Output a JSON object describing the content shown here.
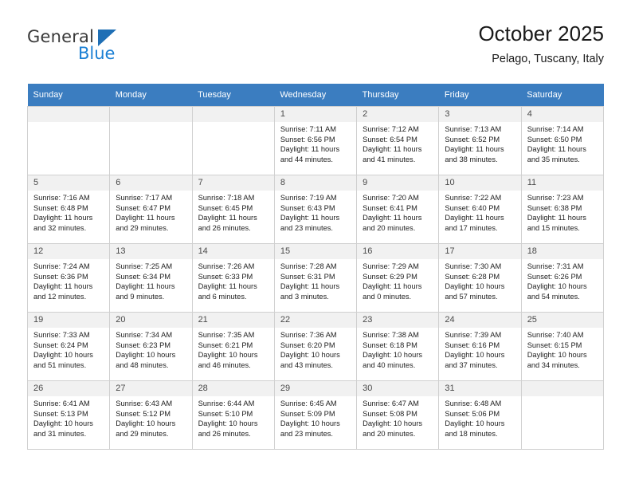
{
  "brand": {
    "name_top": "General",
    "name_bottom": "Blue",
    "accent_color": "#1a7fd4",
    "triangle_color": "#1f6fb5"
  },
  "header": {
    "title": "October 2025",
    "subtitle": "Pelago, Tuscany, Italy"
  },
  "theme": {
    "header_row_bg": "#3b7dc0",
    "daynum_bg": "#f1f1f1",
    "grid_line": "#d0d0d0"
  },
  "weekdays": [
    "Sunday",
    "Monday",
    "Tuesday",
    "Wednesday",
    "Thursday",
    "Friday",
    "Saturday"
  ],
  "labels": {
    "sunrise": "Sunrise:",
    "sunset": "Sunset:",
    "daylight": "Daylight:"
  },
  "weeks": [
    [
      {
        "day": "",
        "empty": true
      },
      {
        "day": "",
        "empty": true
      },
      {
        "day": "",
        "empty": true
      },
      {
        "day": "1",
        "sunrise": "Sunrise: 7:11 AM",
        "sunset": "Sunset: 6:56 PM",
        "daylight_1": "Daylight: 11 hours",
        "daylight_2": "and 44 minutes."
      },
      {
        "day": "2",
        "sunrise": "Sunrise: 7:12 AM",
        "sunset": "Sunset: 6:54 PM",
        "daylight_1": "Daylight: 11 hours",
        "daylight_2": "and 41 minutes."
      },
      {
        "day": "3",
        "sunrise": "Sunrise: 7:13 AM",
        "sunset": "Sunset: 6:52 PM",
        "daylight_1": "Daylight: 11 hours",
        "daylight_2": "and 38 minutes."
      },
      {
        "day": "4",
        "sunrise": "Sunrise: 7:14 AM",
        "sunset": "Sunset: 6:50 PM",
        "daylight_1": "Daylight: 11 hours",
        "daylight_2": "and 35 minutes."
      }
    ],
    [
      {
        "day": "5",
        "sunrise": "Sunrise: 7:16 AM",
        "sunset": "Sunset: 6:48 PM",
        "daylight_1": "Daylight: 11 hours",
        "daylight_2": "and 32 minutes."
      },
      {
        "day": "6",
        "sunrise": "Sunrise: 7:17 AM",
        "sunset": "Sunset: 6:47 PM",
        "daylight_1": "Daylight: 11 hours",
        "daylight_2": "and 29 minutes."
      },
      {
        "day": "7",
        "sunrise": "Sunrise: 7:18 AM",
        "sunset": "Sunset: 6:45 PM",
        "daylight_1": "Daylight: 11 hours",
        "daylight_2": "and 26 minutes."
      },
      {
        "day": "8",
        "sunrise": "Sunrise: 7:19 AM",
        "sunset": "Sunset: 6:43 PM",
        "daylight_1": "Daylight: 11 hours",
        "daylight_2": "and 23 minutes."
      },
      {
        "day": "9",
        "sunrise": "Sunrise: 7:20 AM",
        "sunset": "Sunset: 6:41 PM",
        "daylight_1": "Daylight: 11 hours",
        "daylight_2": "and 20 minutes."
      },
      {
        "day": "10",
        "sunrise": "Sunrise: 7:22 AM",
        "sunset": "Sunset: 6:40 PM",
        "daylight_1": "Daylight: 11 hours",
        "daylight_2": "and 17 minutes."
      },
      {
        "day": "11",
        "sunrise": "Sunrise: 7:23 AM",
        "sunset": "Sunset: 6:38 PM",
        "daylight_1": "Daylight: 11 hours",
        "daylight_2": "and 15 minutes."
      }
    ],
    [
      {
        "day": "12",
        "sunrise": "Sunrise: 7:24 AM",
        "sunset": "Sunset: 6:36 PM",
        "daylight_1": "Daylight: 11 hours",
        "daylight_2": "and 12 minutes."
      },
      {
        "day": "13",
        "sunrise": "Sunrise: 7:25 AM",
        "sunset": "Sunset: 6:34 PM",
        "daylight_1": "Daylight: 11 hours",
        "daylight_2": "and 9 minutes."
      },
      {
        "day": "14",
        "sunrise": "Sunrise: 7:26 AM",
        "sunset": "Sunset: 6:33 PM",
        "daylight_1": "Daylight: 11 hours",
        "daylight_2": "and 6 minutes."
      },
      {
        "day": "15",
        "sunrise": "Sunrise: 7:28 AM",
        "sunset": "Sunset: 6:31 PM",
        "daylight_1": "Daylight: 11 hours",
        "daylight_2": "and 3 minutes."
      },
      {
        "day": "16",
        "sunrise": "Sunrise: 7:29 AM",
        "sunset": "Sunset: 6:29 PM",
        "daylight_1": "Daylight: 11 hours",
        "daylight_2": "and 0 minutes."
      },
      {
        "day": "17",
        "sunrise": "Sunrise: 7:30 AM",
        "sunset": "Sunset: 6:28 PM",
        "daylight_1": "Daylight: 10 hours",
        "daylight_2": "and 57 minutes."
      },
      {
        "day": "18",
        "sunrise": "Sunrise: 7:31 AM",
        "sunset": "Sunset: 6:26 PM",
        "daylight_1": "Daylight: 10 hours",
        "daylight_2": "and 54 minutes."
      }
    ],
    [
      {
        "day": "19",
        "sunrise": "Sunrise: 7:33 AM",
        "sunset": "Sunset: 6:24 PM",
        "daylight_1": "Daylight: 10 hours",
        "daylight_2": "and 51 minutes."
      },
      {
        "day": "20",
        "sunrise": "Sunrise: 7:34 AM",
        "sunset": "Sunset: 6:23 PM",
        "daylight_1": "Daylight: 10 hours",
        "daylight_2": "and 48 minutes."
      },
      {
        "day": "21",
        "sunrise": "Sunrise: 7:35 AM",
        "sunset": "Sunset: 6:21 PM",
        "daylight_1": "Daylight: 10 hours",
        "daylight_2": "and 46 minutes."
      },
      {
        "day": "22",
        "sunrise": "Sunrise: 7:36 AM",
        "sunset": "Sunset: 6:20 PM",
        "daylight_1": "Daylight: 10 hours",
        "daylight_2": "and 43 minutes."
      },
      {
        "day": "23",
        "sunrise": "Sunrise: 7:38 AM",
        "sunset": "Sunset: 6:18 PM",
        "daylight_1": "Daylight: 10 hours",
        "daylight_2": "and 40 minutes."
      },
      {
        "day": "24",
        "sunrise": "Sunrise: 7:39 AM",
        "sunset": "Sunset: 6:16 PM",
        "daylight_1": "Daylight: 10 hours",
        "daylight_2": "and 37 minutes."
      },
      {
        "day": "25",
        "sunrise": "Sunrise: 7:40 AM",
        "sunset": "Sunset: 6:15 PM",
        "daylight_1": "Daylight: 10 hours",
        "daylight_2": "and 34 minutes."
      }
    ],
    [
      {
        "day": "26",
        "sunrise": "Sunrise: 6:41 AM",
        "sunset": "Sunset: 5:13 PM",
        "daylight_1": "Daylight: 10 hours",
        "daylight_2": "and 31 minutes."
      },
      {
        "day": "27",
        "sunrise": "Sunrise: 6:43 AM",
        "sunset": "Sunset: 5:12 PM",
        "daylight_1": "Daylight: 10 hours",
        "daylight_2": "and 29 minutes."
      },
      {
        "day": "28",
        "sunrise": "Sunrise: 6:44 AM",
        "sunset": "Sunset: 5:10 PM",
        "daylight_1": "Daylight: 10 hours",
        "daylight_2": "and 26 minutes."
      },
      {
        "day": "29",
        "sunrise": "Sunrise: 6:45 AM",
        "sunset": "Sunset: 5:09 PM",
        "daylight_1": "Daylight: 10 hours",
        "daylight_2": "and 23 minutes."
      },
      {
        "day": "30",
        "sunrise": "Sunrise: 6:47 AM",
        "sunset": "Sunset: 5:08 PM",
        "daylight_1": "Daylight: 10 hours",
        "daylight_2": "and 20 minutes."
      },
      {
        "day": "31",
        "sunrise": "Sunrise: 6:48 AM",
        "sunset": "Sunset: 5:06 PM",
        "daylight_1": "Daylight: 10 hours",
        "daylight_2": "and 18 minutes."
      },
      {
        "day": "",
        "empty": true
      }
    ]
  ]
}
